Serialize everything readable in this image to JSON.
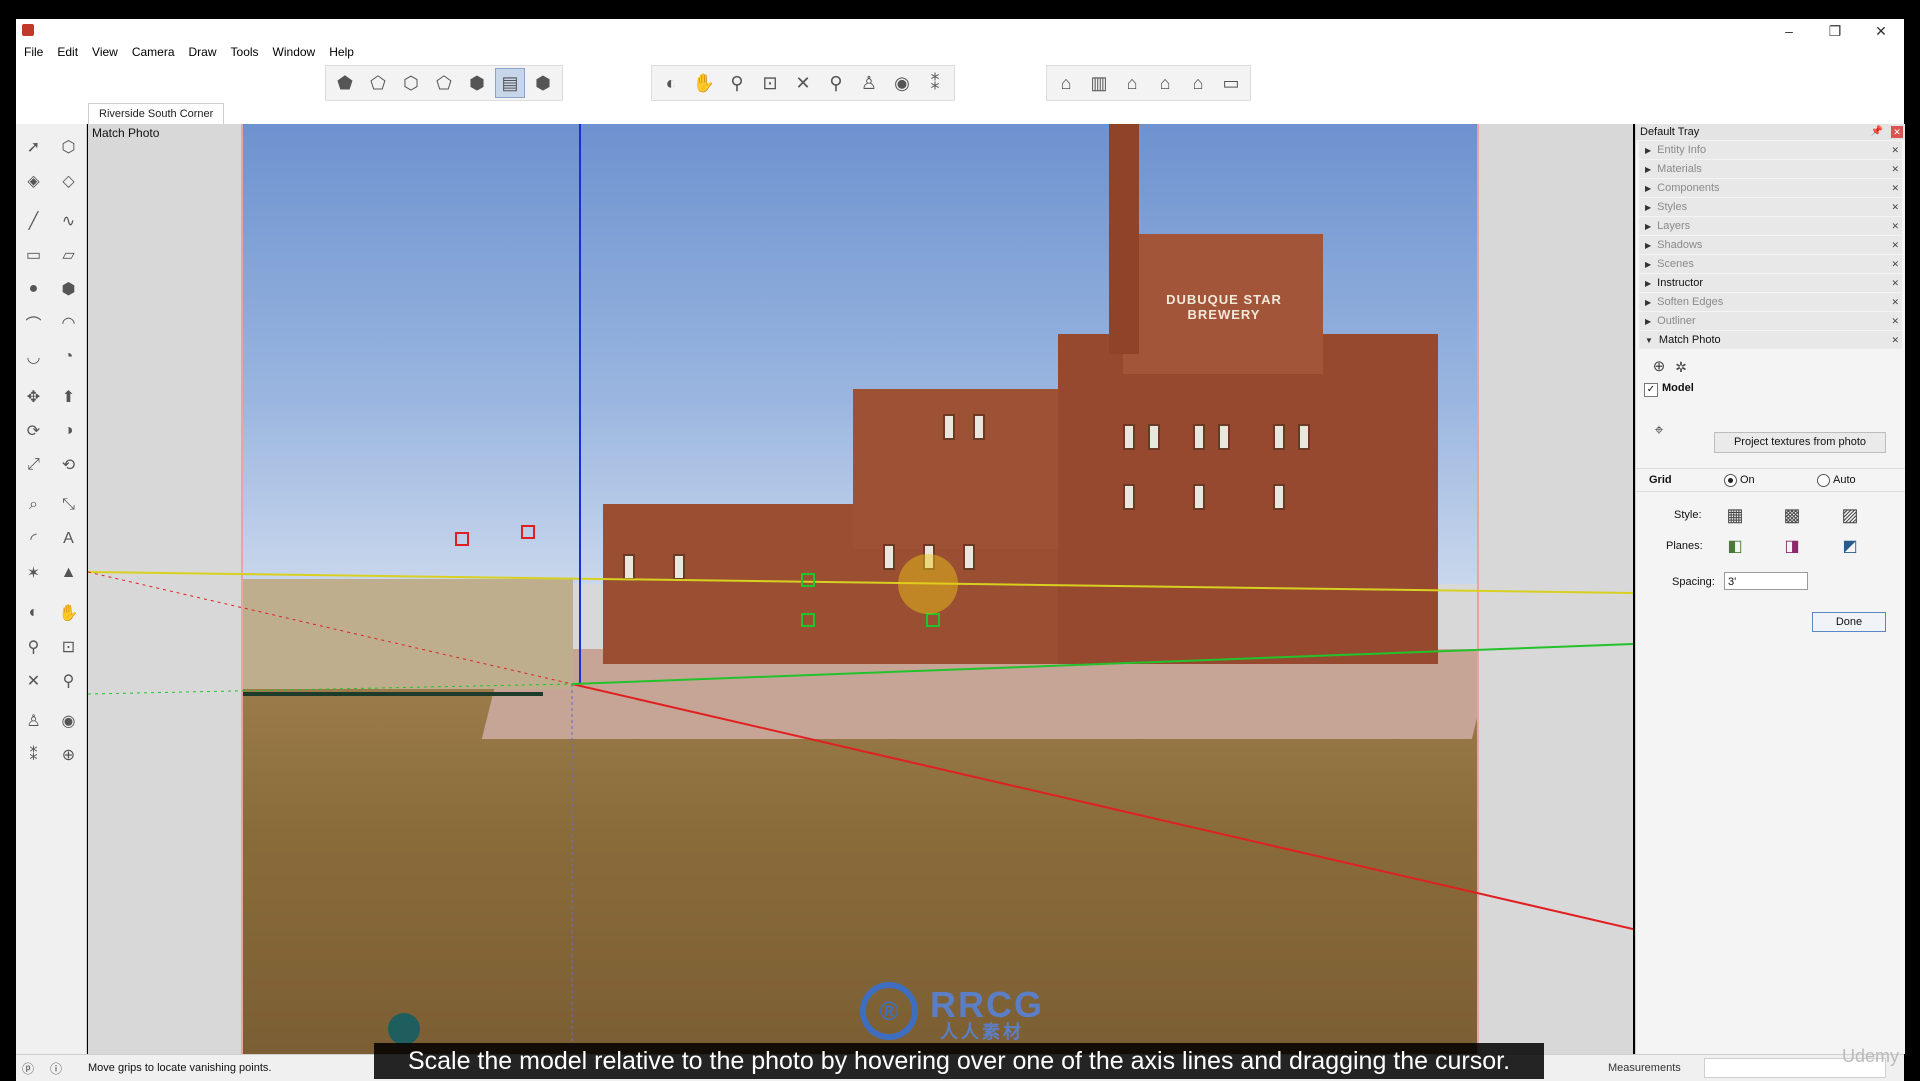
{
  "window": {
    "title": "",
    "controls": [
      "–",
      "❐",
      "✕"
    ]
  },
  "menu": [
    "File",
    "Edit",
    "View",
    "Camera",
    "Draw",
    "Tools",
    "Window",
    "Help"
  ],
  "scene_tab": "Riverside South Corner",
  "viewport_label": "Match Photo",
  "tray": {
    "title": "Default Tray",
    "panels": [
      {
        "label": "Entity Info",
        "expanded": false
      },
      {
        "label": "Materials",
        "expanded": false
      },
      {
        "label": "Components",
        "expanded": false
      },
      {
        "label": "Styles",
        "expanded": false
      },
      {
        "label": "Layers",
        "expanded": false
      },
      {
        "label": "Shadows",
        "expanded": false
      },
      {
        "label": "Scenes",
        "expanded": false
      },
      {
        "label": "Instructor",
        "expanded": false
      },
      {
        "label": "Soften Edges",
        "expanded": false
      },
      {
        "label": "Outliner",
        "expanded": false
      },
      {
        "label": "Match Photo",
        "expanded": true
      }
    ],
    "match_photo": {
      "model_label": "Model",
      "model_checked": true,
      "project_button": "Project textures from photo",
      "grid_label": "Grid",
      "grid_on_label": "On",
      "grid_auto_label": "Auto",
      "grid_selected": "On",
      "style_label": "Style:",
      "planes_label": "Planes:",
      "spacing_label": "Spacing:",
      "spacing_value": "3'",
      "done_button": "Done"
    }
  },
  "status": {
    "text": "Move grips to locate vanishing points.",
    "measurements_label": "Measurements"
  },
  "caption": "Scale the model relative to the photo by hovering over one of the axis lines and dragging the cursor.",
  "watermark": {
    "mark": "RRCG",
    "sub": "人人素材",
    "udemy": "Udemy"
  },
  "photo_text": {
    "sign": "DUBUQUE STAR BREWERY"
  },
  "colors": {
    "x_axis": "#e02020",
    "y_axis": "#22c22a",
    "z_axis": "#1a2fd6",
    "horizon": "#d8d020",
    "accent": "#5b86c5"
  }
}
